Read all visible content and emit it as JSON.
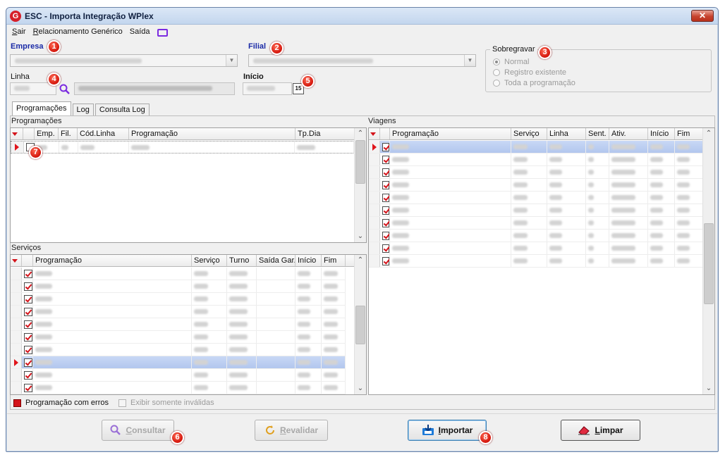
{
  "window": {
    "title": "ESC - Importa Integração WPlex",
    "close_label": "✕",
    "logo_letter": "G"
  },
  "menu": {
    "items": [
      {
        "underline": "S",
        "rest": "air"
      },
      {
        "underline": "R",
        "rest": "elacionamento Genérico"
      },
      {
        "underline": "",
        "rest": "Saída"
      }
    ]
  },
  "form": {
    "empresa_label": "Empresa",
    "filial_label": "Filial",
    "linha_label": "Linha",
    "inicio_label": "Início",
    "calendar_label": "15"
  },
  "sobregravar": {
    "legend": "Sobregravar",
    "options": [
      {
        "label": "Normal",
        "selected": true
      },
      {
        "label": "Registro existente",
        "selected": false
      },
      {
        "label": "Toda a programação",
        "selected": false
      }
    ]
  },
  "tabs": [
    {
      "label": "Programações",
      "active": true
    },
    {
      "label": "Log",
      "active": false
    },
    {
      "label": "Consulta Log",
      "active": false
    }
  ],
  "programacoes": {
    "title": "Programações",
    "columns": [
      "Emp.",
      "Fil.",
      "Cód.Linha",
      "Programação",
      "Tp.Dia"
    ]
  },
  "servicos": {
    "title": "Serviços",
    "columns": [
      "Programação",
      "Serviço",
      "Turno",
      "Saída Gar.",
      "Início",
      "Fim"
    ],
    "rows": 10,
    "selected_row": 7
  },
  "viagens": {
    "title": "Viagens",
    "columns": [
      "Programação",
      "Serviço",
      "Linha",
      "Sent.",
      "Ativ.",
      "Início",
      "Fim"
    ],
    "rows": 10,
    "selected_row": 0
  },
  "legend": {
    "error_label": "Programação com erros",
    "only_invalid_label": "Exibir somente inválidas"
  },
  "buttons": {
    "consultar": {
      "underline": "C",
      "rest": "onsultar"
    },
    "revalidar": {
      "underline": "R",
      "rest": "evalidar"
    },
    "importar": {
      "underline": "I",
      "rest": "mportar"
    },
    "limpar": {
      "underline": "L",
      "rest": "impar"
    }
  },
  "callouts": [
    "1",
    "2",
    "3",
    "4",
    "5",
    "6",
    "7",
    "8"
  ],
  "colors": {
    "accent_red": "#d4141b",
    "label_blue": "#1a2aa6",
    "selection": "#b2c7ee"
  }
}
